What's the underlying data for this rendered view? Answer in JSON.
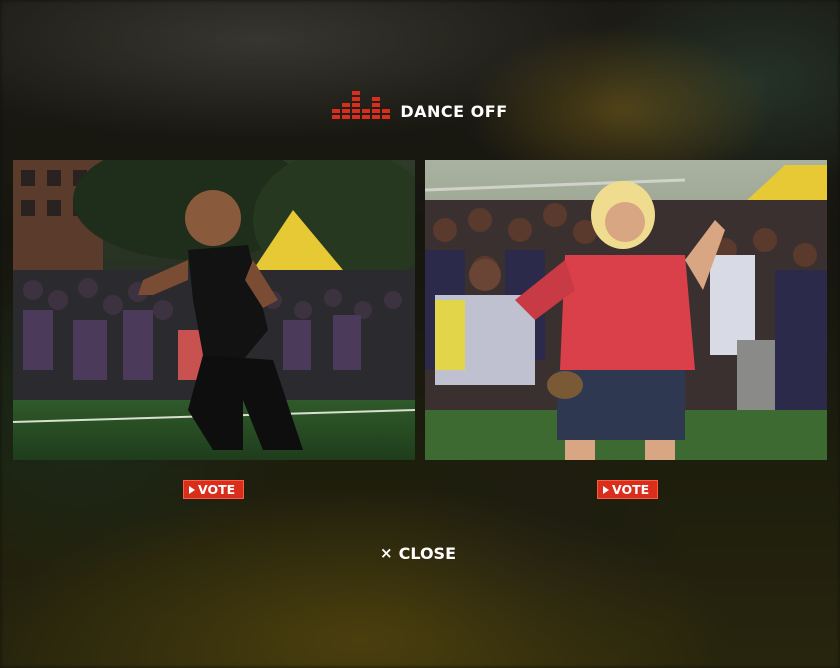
{
  "header": {
    "title": "DANCE OFF",
    "logo_icon": "equalizer-logo-icon",
    "brand_color": "#d92e1c"
  },
  "contestants": [
    {
      "image_alt": "Boy dancing in front of crowd",
      "vote_label": "VOTE"
    },
    {
      "image_alt": "Woman dancing in front of crowd",
      "vote_label": "VOTE"
    }
  ],
  "close": {
    "icon": "close-icon",
    "glyph": "×",
    "label": "CLOSE"
  }
}
